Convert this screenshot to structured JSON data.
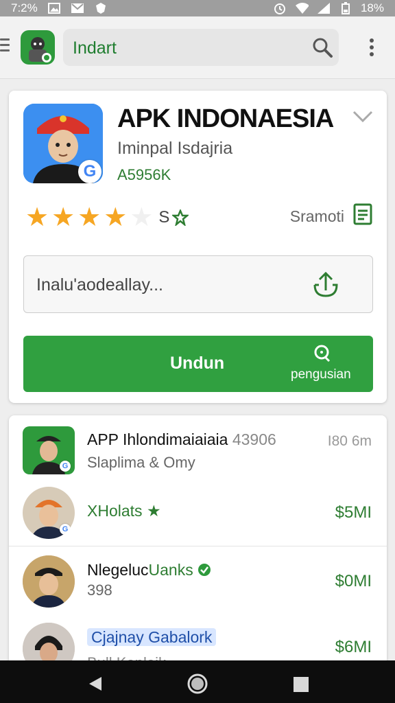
{
  "status_bar": {
    "time": "7:2%",
    "battery": "18%"
  },
  "app_bar": {
    "search_value": "Indart"
  },
  "app_card": {
    "title": "APK INDONAESIA",
    "subtitle": "Iminpal Isdajria",
    "size": "A5956K",
    "rating": {
      "value": 4,
      "max": 5,
      "text": "S"
    },
    "review_label": "Sramoti",
    "install_field_value": "Inalu'aodeallay...",
    "primary_button": {
      "label": "Undun",
      "sublabel": "pengusian"
    }
  },
  "list": {
    "items": [
      {
        "title": "APP Ihlondimaiaiaia",
        "number": "43906",
        "meta": "I80 6m",
        "subtitle": "Slaplima & Omy"
      },
      {
        "title": "XHolats",
        "price": "$5MI"
      },
      {
        "title_prefix": "Nlegeluc",
        "title_suffix": "Uanks",
        "subtitle": "398",
        "price": "$0MI"
      },
      {
        "chip_text": "Cjajnay",
        "chip_text2": "Gabalork",
        "subtitle": "Bull Kanlajk",
        "price": "$6MI"
      }
    ]
  },
  "colors": {
    "accent": "#30a040",
    "brand_green": "#2e7d32",
    "star": "#f6a623"
  }
}
